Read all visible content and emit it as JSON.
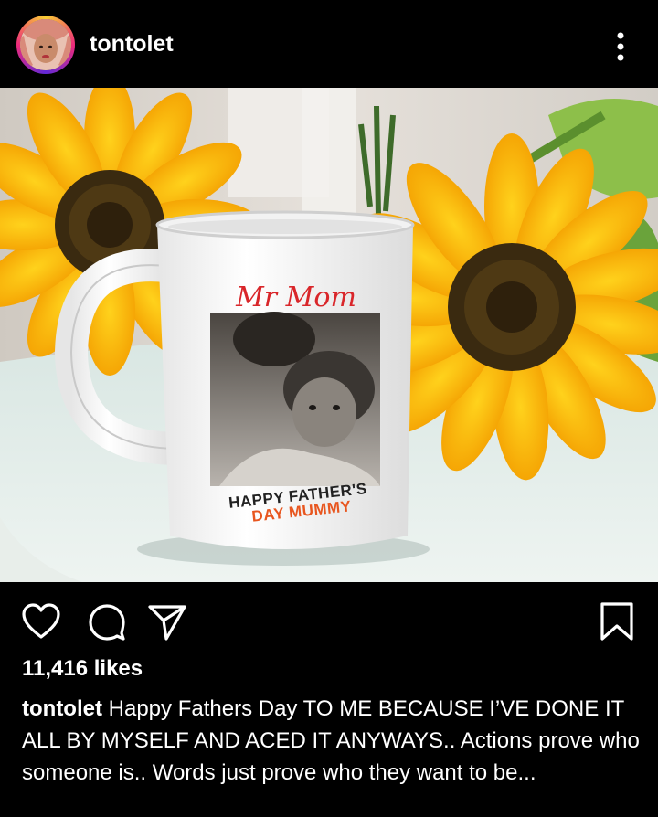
{
  "header": {
    "username": "tontolet",
    "avatar_icon": "profile-avatar",
    "more_icon": "more-vertical-icon"
  },
  "post": {
    "mug_title": "Mr Mom",
    "mug_line1": "HAPPY FATHER'S",
    "mug_line2": "DAY MUMMY"
  },
  "actions": {
    "like_icon": "heart-icon",
    "comment_icon": "comment-icon",
    "share_icon": "send-icon",
    "save_icon": "bookmark-icon"
  },
  "likes_text": "11,416 likes",
  "caption": {
    "username": "tontolet",
    "text": "Happy Fathers Day TO ME BECAUSE I’VE DONE IT ALL BY MYSELF AND ACED IT ANYWAYS.. Actions prove who someone is.. Words just prove who they want to be..."
  },
  "colors": {
    "background": "#000000",
    "text": "#ffffff",
    "sunflower": "#f7b500",
    "mug_red": "#d9262a",
    "mug_orange": "#e8561f"
  }
}
